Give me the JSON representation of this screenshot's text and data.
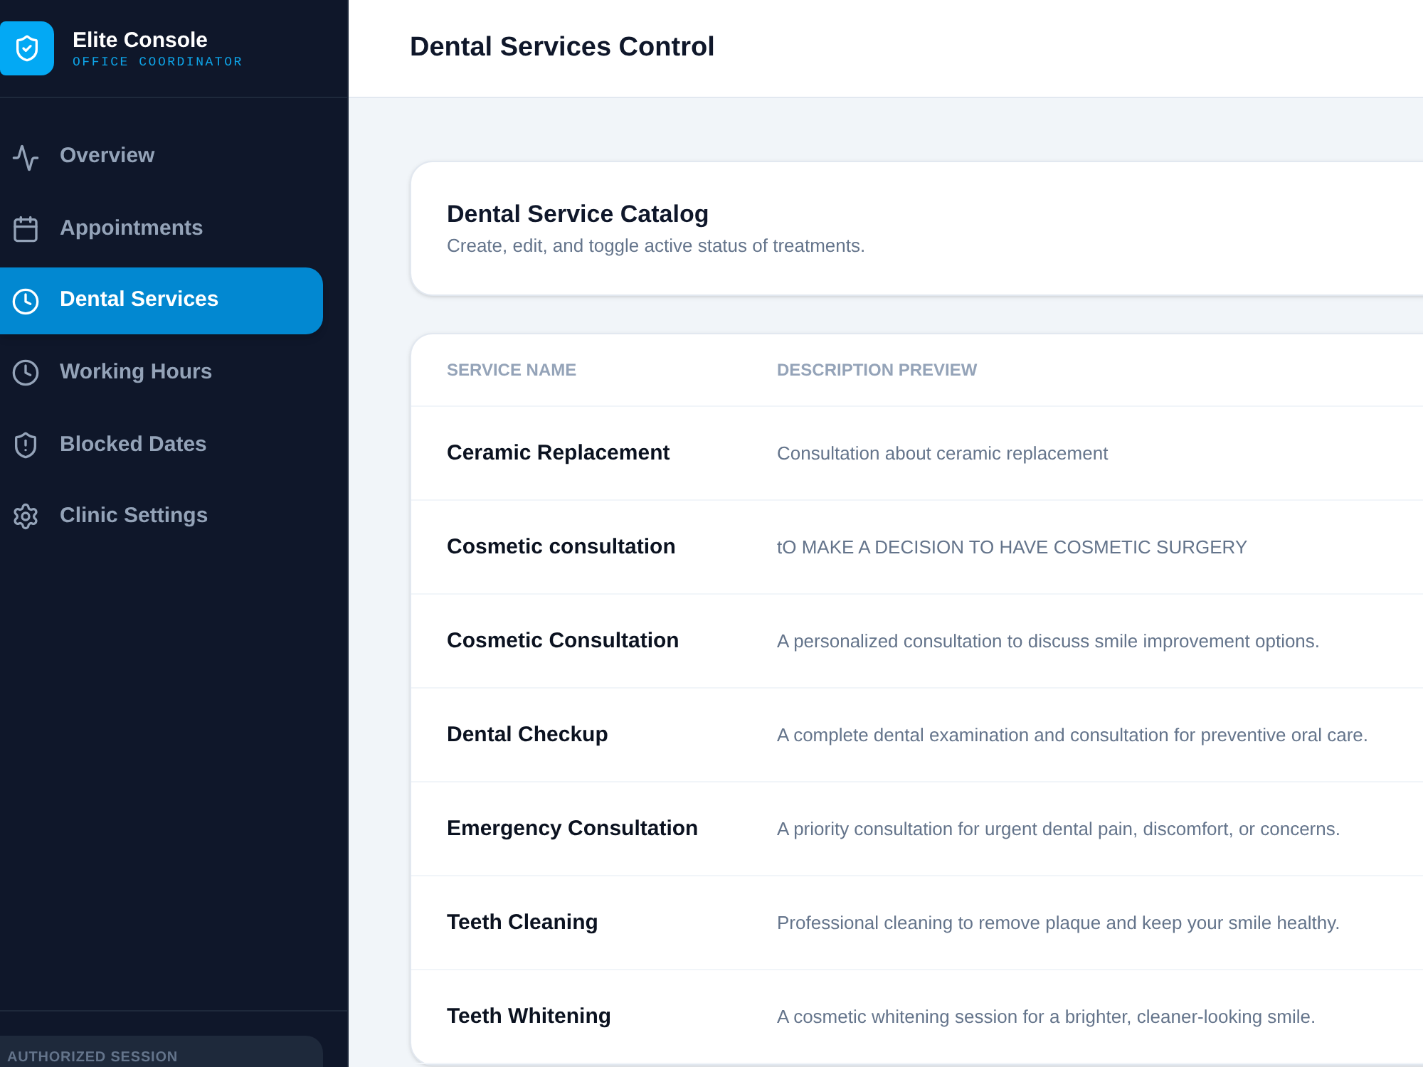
{
  "brand": {
    "title": "Elite Console",
    "subtitle": "OFFICE COORDINATOR"
  },
  "nav": {
    "items": [
      {
        "label": "Overview",
        "selected": false
      },
      {
        "label": "Appointments",
        "selected": false
      },
      {
        "label": "Dental Services",
        "selected": true
      },
      {
        "label": "Working Hours",
        "selected": false
      },
      {
        "label": "Blocked Dates",
        "selected": false
      },
      {
        "label": "Clinic Settings",
        "selected": false
      }
    ]
  },
  "session": {
    "label": "AUTHORIZED SESSION"
  },
  "header": {
    "title": "Dental Services Control"
  },
  "catalog": {
    "title": "Dental Service Catalog",
    "description": "Create, edit, and toggle active status of treatments."
  },
  "table": {
    "columns": [
      "SERVICE NAME",
      "DESCRIPTION PREVIEW"
    ],
    "rows": [
      {
        "name": "Ceramic Replacement",
        "description": "Consultation about ceramic replacement"
      },
      {
        "name": "Cosmetic consultation",
        "description": "tO MAKE A DECISION TO HAVE COSMETIC SURGERY"
      },
      {
        "name": "Cosmetic Consultation",
        "description": "A personalized consultation to discuss smile improvement options."
      },
      {
        "name": "Dental Checkup",
        "description": "A complete dental examination and consultation for preventive oral care."
      },
      {
        "name": "Emergency Consultation",
        "description": "A priority consultation for urgent dental pain, discomfort, or concerns."
      },
      {
        "name": "Teeth Cleaning",
        "description": "Professional cleaning to remove plaque and keep your smile healthy."
      },
      {
        "name": "Teeth Whitening",
        "description": "A cosmetic whitening session for a brighter, cleaner-looking smile."
      }
    ]
  }
}
